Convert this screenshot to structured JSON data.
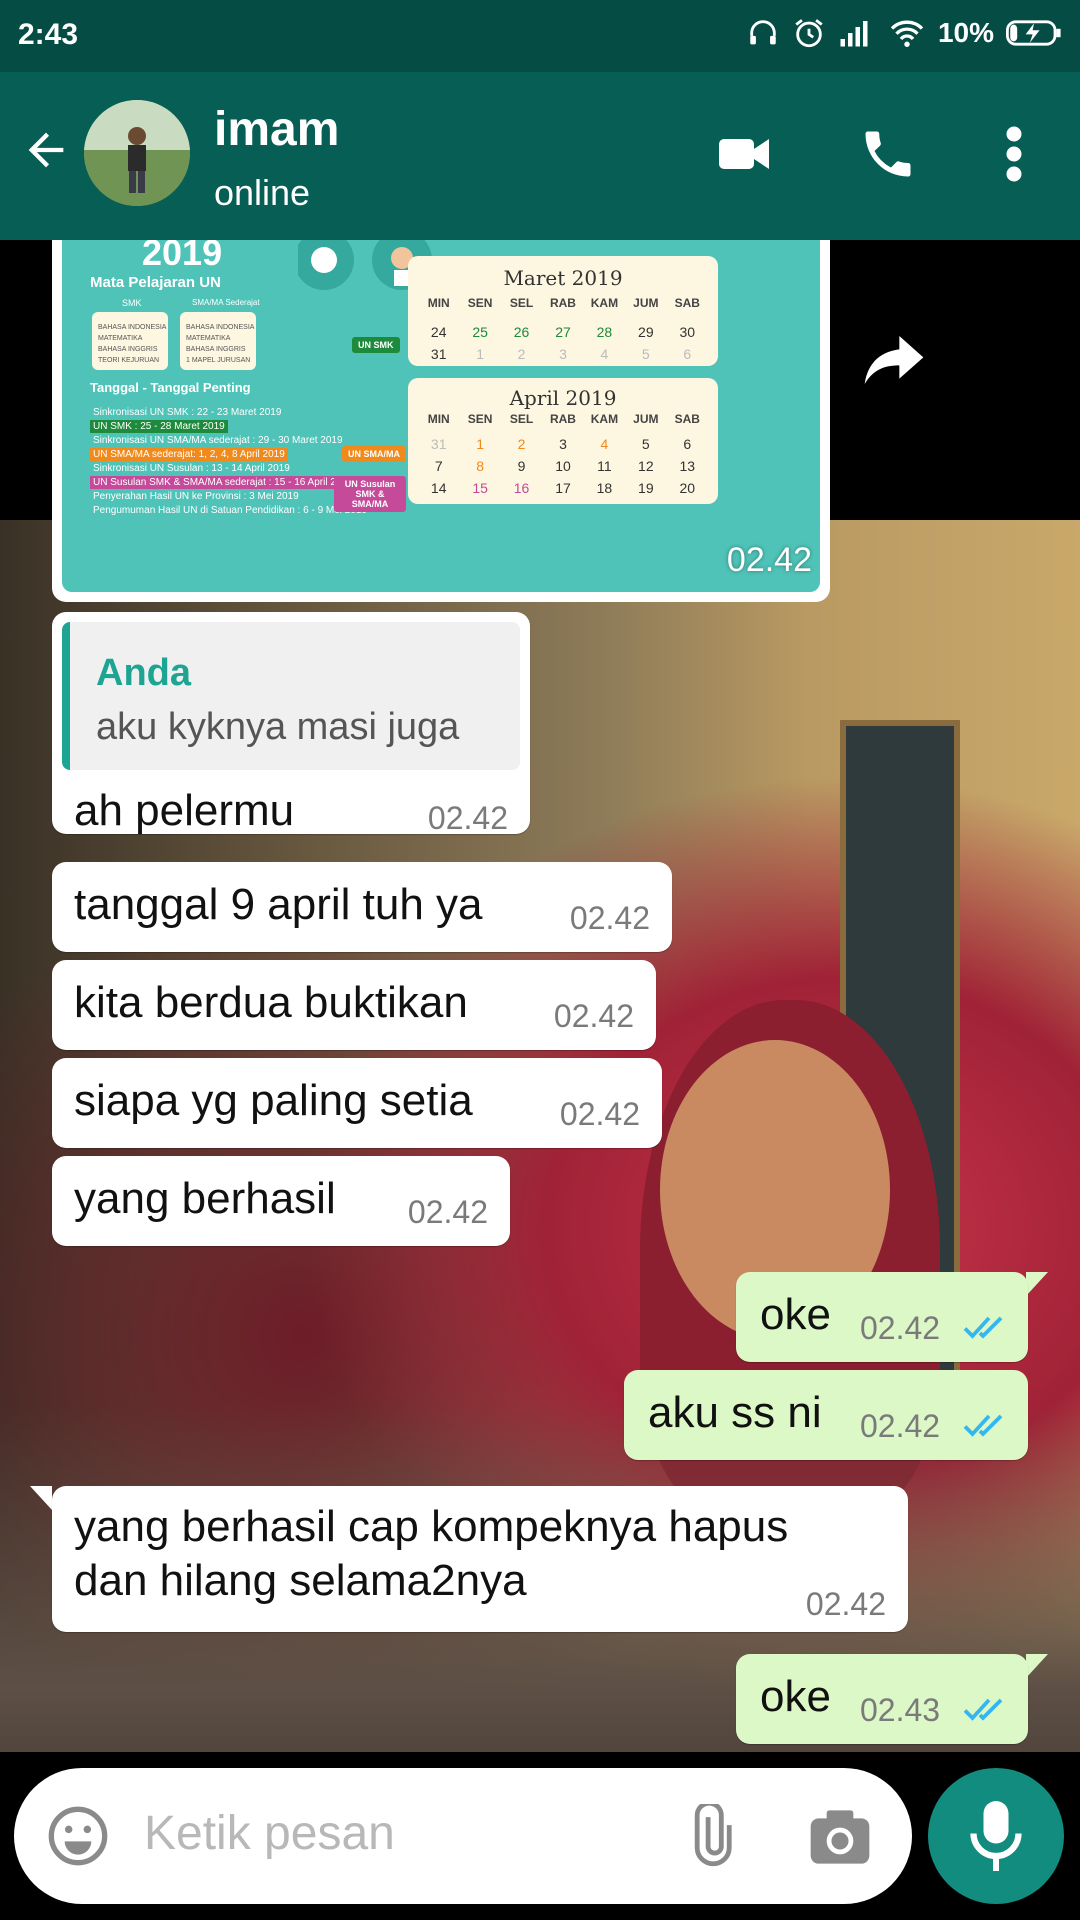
{
  "status_bar": {
    "time": "2:43",
    "battery": "10%"
  },
  "header": {
    "contact_name": "imam",
    "contact_status": "online"
  },
  "image_message": {
    "time": "02.42",
    "infographic": {
      "year": "2019",
      "subjects_title": "Mata Pelajaran UN",
      "smk_label": "SMK",
      "sma_label": "SMA/MA Sederajat",
      "smk_subjects": [
        "BAHASA INDONESIA",
        "MATEMATIKA",
        "BAHASA INGGRIS",
        "TEORI KEJURUAN"
      ],
      "sma_subjects": [
        "BAHASA INDONESIA",
        "MATEMATIKA",
        "BAHASA INGGRIS",
        "1 MAPEL JURUSAN"
      ],
      "dates_title": "Tanggal - Tanggal Penting",
      "dates": [
        "Sinkronisasi UN SMK : 22 - 23 Maret 2019",
        "UN SMK : 25 - 28 Maret 2019",
        "Sinkronisasi UN SMA/MA sederajat : 29 - 30 Maret 2019",
        "UN SMA/MA sederajat: 1, 2, 4, 8 April 2019",
        "Sinkronisasi UN Susulan : 13 - 14 April 2019",
        "UN Susulan SMK & SMA/MA sederajat : 15 - 16 April 2019",
        "Penyerahan Hasil UN ke Provinsi : 3 Mei 2019",
        "Pengumuman Hasil UN di Satuan Pendidikan : 6 - 9 Mei 2019"
      ],
      "tag_smk": "UN SMK",
      "tag_sma": "UN SMA/MA",
      "tag_susulan": "UN Susulan SMK & SMA/MA",
      "days": [
        "MIN",
        "SEN",
        "SEL",
        "RAB",
        "KAM",
        "JUM",
        "SAB"
      ],
      "march_title": "Maret 2019",
      "march_rows": [
        [
          "24",
          "25",
          "26",
          "27",
          "28",
          "29",
          "30"
        ],
        [
          "31",
          "1",
          "2",
          "3",
          "4",
          "5",
          "6"
        ]
      ],
      "april_title": "April 2019",
      "april_rows": [
        [
          "31",
          "1",
          "2",
          "3",
          "4",
          "5",
          "6"
        ],
        [
          "7",
          "8",
          "9",
          "10",
          "11",
          "12",
          "13"
        ],
        [
          "14",
          "15",
          "16",
          "17",
          "18",
          "19",
          "20"
        ]
      ]
    }
  },
  "messages": [
    {
      "id": "m1",
      "direction": "in",
      "quote_name": "Anda",
      "quote_text": "aku kyknya masi juga",
      "text": "ah pelermu",
      "time": "02.42"
    },
    {
      "id": "m2",
      "direction": "in",
      "text": "tanggal 9 april tuh ya",
      "time": "02.42"
    },
    {
      "id": "m3",
      "direction": "in",
      "text": "kita berdua buktikan",
      "time": "02.42"
    },
    {
      "id": "m4",
      "direction": "in",
      "text": "siapa yg paling setia",
      "time": "02.42"
    },
    {
      "id": "m5",
      "direction": "in",
      "text": "yang berhasil",
      "time": "02.42"
    },
    {
      "id": "m6",
      "direction": "out",
      "text": "oke",
      "time": "02.42"
    },
    {
      "id": "m7",
      "direction": "out",
      "text": "aku ss ni",
      "time": "02.42"
    },
    {
      "id": "m8",
      "direction": "in",
      "text_line1": "yang berhasil cap kompeknya hapus",
      "text_line2": "dan hilang selama2nya",
      "time": "02.42"
    },
    {
      "id": "m9",
      "direction": "out",
      "text": "oke",
      "time": "02.43"
    }
  ],
  "input": {
    "placeholder": "Ketik pesan"
  },
  "colors": {
    "header": "#075e54",
    "statusbar": "#054d44",
    "accent": "#128c7e",
    "outgoing_bubble": "#dcf8c6",
    "read_ticks": "#34b7f1"
  },
  "icons": [
    "back-arrow-icon",
    "video-call-icon",
    "phone-icon",
    "more-vert-icon",
    "forward-icon",
    "emoji-icon",
    "attach-icon",
    "camera-icon",
    "mic-icon",
    "double-check-icon"
  ]
}
